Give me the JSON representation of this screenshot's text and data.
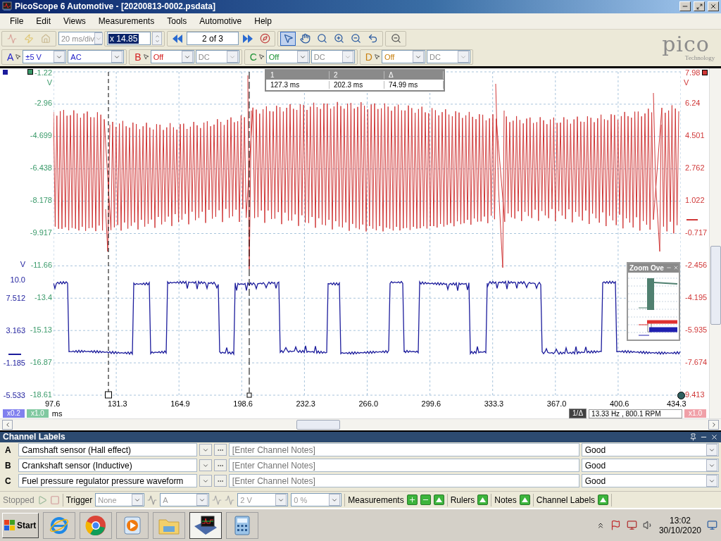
{
  "window": {
    "title": "PicoScope 6 Automotive - [20200813-0002.psdata]"
  },
  "menu": [
    {
      "label": "File"
    },
    {
      "label": "Edit"
    },
    {
      "label": "Views"
    },
    {
      "label": "Measurements"
    },
    {
      "label": "Tools"
    },
    {
      "label": "Automotive"
    },
    {
      "label": "Help"
    }
  ],
  "toolbar": {
    "timebase": {
      "value": "20 ms/div",
      "disabled": true
    },
    "zoom": {
      "value": "x 14.85"
    },
    "buffer": {
      "value": "2 of 3"
    },
    "tools": [
      {
        "kind": "pointer",
        "selected": true
      },
      {
        "kind": "hand",
        "selected": false
      },
      {
        "kind": "zoom-box",
        "selected": false
      },
      {
        "kind": "zoom-in",
        "selected": false
      },
      {
        "kind": "zoom-out",
        "selected": false
      },
      {
        "kind": "undo",
        "selected": false
      }
    ]
  },
  "logo": {
    "text": "pico",
    "subtitle": "Technology"
  },
  "channels": [
    {
      "letter": "A",
      "color": "#1c1cc8",
      "range": "±5 V",
      "coupling": "AC",
      "enabled": true
    },
    {
      "letter": "B",
      "color": "#d42020",
      "range": "Off",
      "coupling": "DC",
      "enabled": false
    },
    {
      "letter": "C",
      "color": "#189030",
      "range": "Off",
      "coupling": "DC",
      "enabled": false
    },
    {
      "letter": "D",
      "color": "#c88010",
      "range": "Off",
      "coupling": "DC",
      "enabled": false
    }
  ],
  "scope": {
    "axes": [
      {
        "color": "#1c1c9c",
        "unit": "V",
        "ticks": [
          "10.0",
          "7.512",
          "3.163",
          "-1.185",
          "-5.533"
        ]
      },
      {
        "color": "#3a9a6a",
        "unit": "V",
        "ticks": [
          "-1.22",
          "-2.96",
          "-4.699",
          "-6.438",
          "-8.178",
          "-9.917",
          "-11.66",
          "-13.4",
          "-15.13",
          "-16.87",
          "-18.61"
        ]
      },
      {
        "color": "#d03838",
        "unit": "V",
        "ticks": [
          "7.98",
          "6.24",
          "4.501",
          "2.762",
          "1.022",
          "-0.717",
          "-2.456",
          "-4.195",
          "-5.935",
          "-7.674",
          "9.413"
        ]
      }
    ],
    "x_ticks": [
      "97.6",
      "131.3",
      "164.9",
      "198.6",
      "232.3",
      "266.0",
      "299.6",
      "333.3",
      "367.0",
      "400.6",
      "434.3"
    ],
    "x_unit": "ms",
    "scale_badges": [
      {
        "text": "x0.2",
        "color": "#8080ee"
      },
      {
        "text": "x1.0",
        "color": "#80c8a0"
      }
    ],
    "right_badge": {
      "text": "x1.0",
      "color": "#f0a0a8"
    },
    "ruler_table": {
      "columns": [
        "1",
        "2",
        "Δ"
      ],
      "values": [
        "127.3 ms",
        "202.3 ms",
        "74.99 ms"
      ]
    },
    "frequency": {
      "label": "1/Δ",
      "value": "13.33 Hz , 800.1 RPM"
    },
    "zoom_overview": {
      "title": "Zoom Ove"
    }
  },
  "channel_labels": {
    "title": "Channel Labels",
    "rows": [
      {
        "letter": "A",
        "label": "Camshaft sensor (Hall effect)",
        "notes_placeholder": "[Enter Channel Notes]",
        "status": "Good"
      },
      {
        "letter": "B",
        "label": "Crankshaft sensor (Inductive)",
        "notes_placeholder": "[Enter Channel Notes]",
        "status": "Good"
      },
      {
        "letter": "C",
        "label": "Fuel pressure regulator pressure waveform",
        "notes_placeholder": "[Enter Channel Notes]",
        "status": "Good"
      }
    ]
  },
  "status_bar": {
    "state": "Stopped",
    "trigger": "Trigger",
    "trigger_mode": "None",
    "trigger_source": "A",
    "threshold": "2 V",
    "pretrigger": "0 %",
    "sections": [
      {
        "label": "Measurements",
        "kind": "measurements"
      },
      {
        "label": "Rulers",
        "kind": "toggle"
      },
      {
        "label": "Notes",
        "kind": "toggle"
      },
      {
        "label": "Channel Labels",
        "kind": "toggle"
      }
    ]
  },
  "taskbar": {
    "start": "Start",
    "apps": [
      {
        "kind": "globe",
        "selected": false
      },
      {
        "kind": "wheel",
        "selected": false
      },
      {
        "kind": "play",
        "selected": false
      },
      {
        "kind": "folder",
        "selected": false
      },
      {
        "kind": "scope",
        "selected": true
      },
      {
        "kind": "calculator",
        "selected": false
      }
    ],
    "time": "13:02",
    "date": "30/10/2020"
  }
}
